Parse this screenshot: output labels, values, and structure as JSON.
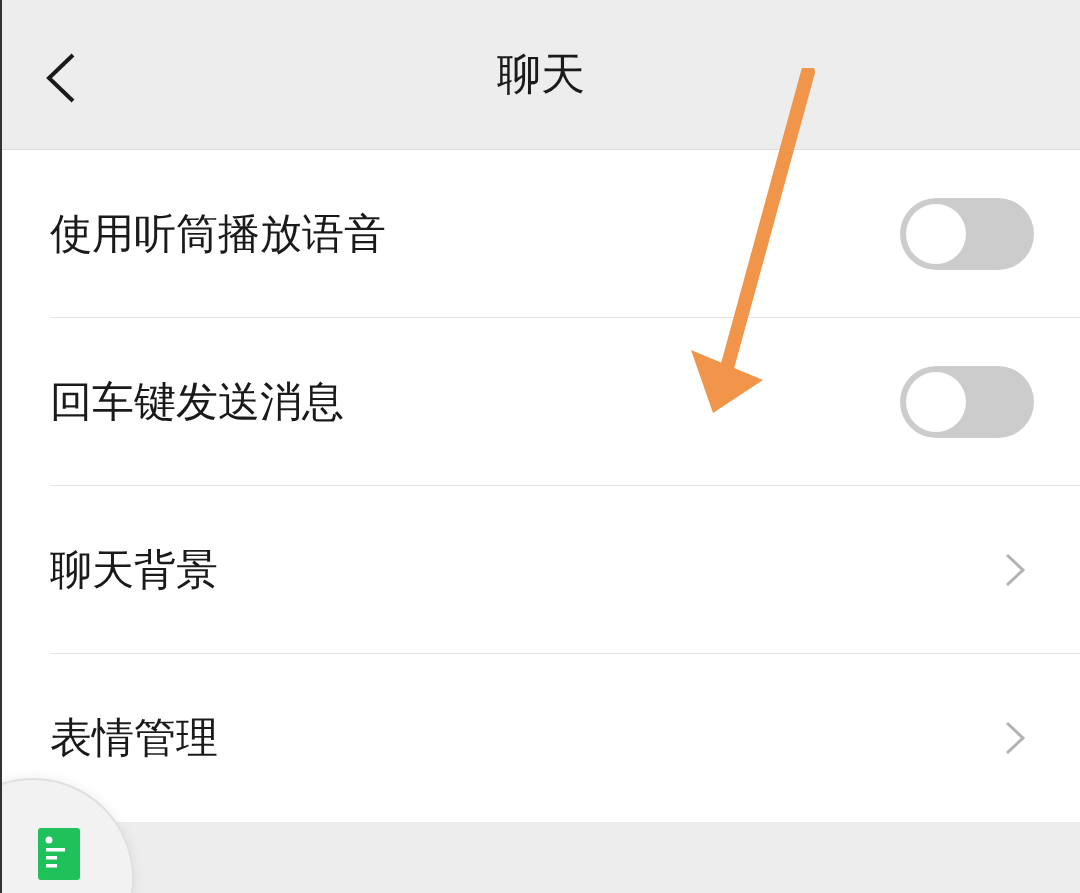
{
  "header": {
    "title": "聊天"
  },
  "items": [
    {
      "label": "使用听筒播放语音",
      "kind": "toggle",
      "on": false
    },
    {
      "label": "回车键发送消息",
      "kind": "toggle",
      "on": false
    },
    {
      "label": "聊天背景",
      "kind": "link"
    },
    {
      "label": "表情管理",
      "kind": "link"
    }
  ]
}
